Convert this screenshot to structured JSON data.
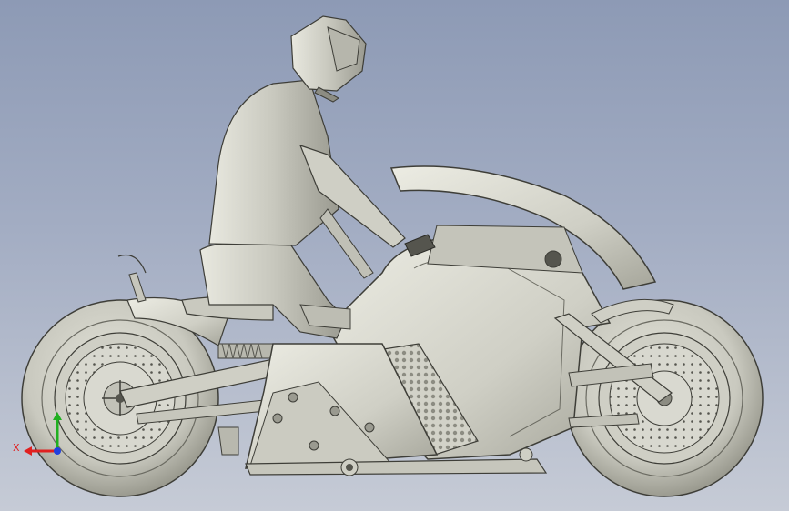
{
  "viewport": {
    "background_top": "#8d9ab5",
    "background_bottom": "#c6cbd6",
    "model_fill": "#d6d6cc",
    "model_shade": "#a9a99e",
    "model_edge": "#3e3e38"
  },
  "triad": {
    "x_label": "X",
    "x_color": "#e02020",
    "y_color": "#20b020",
    "z_color": "#2040e0"
  }
}
